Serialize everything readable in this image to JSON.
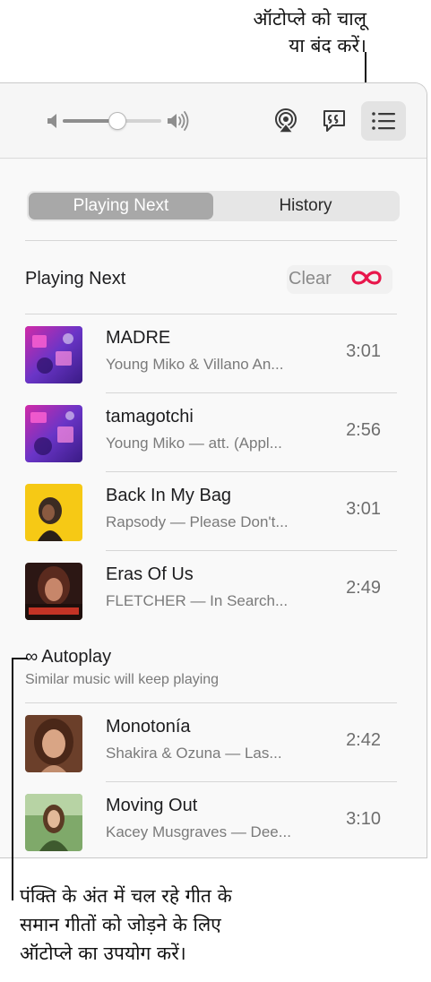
{
  "callouts": {
    "autoplay_toggle_line1": "ऑटोप्ले को चालू",
    "autoplay_toggle_line2": "या बंद करें।",
    "autoplay_use_line1": "पंक्ति के अंत में चल रहे गीत के",
    "autoplay_use_line2": "समान गीतों को जोड़ने के लिए",
    "autoplay_use_line3": "ऑटोप्ले का उपयोग करें।"
  },
  "toolbar": {
    "volume_level": 0.55,
    "icons": [
      "volume-low-icon",
      "volume-high-icon",
      "airplay-icon",
      "lyrics-icon",
      "queue-list-icon"
    ]
  },
  "tabs": [
    {
      "label": "Playing Next",
      "active": true
    },
    {
      "label": "History",
      "active": false
    }
  ],
  "playing_next": {
    "title": "Playing Next",
    "clear_label": "Clear",
    "autoplay_symbol": "∞",
    "autoplay_color": "#e8164b",
    "tracks": [
      {
        "title": "MADRE",
        "subtitle": "Young Miko & Villano An...",
        "duration": "3:01",
        "art": "purple"
      },
      {
        "title": "tamagotchi",
        "subtitle": "Young Miko — att. (Appl...",
        "duration": "2:56",
        "art": "purple"
      },
      {
        "title": "Back In My Bag",
        "subtitle": "Rapsody — Please Don't...",
        "duration": "3:01",
        "art": "yellow"
      },
      {
        "title": "Eras Of Us",
        "subtitle": "FLETCHER — In Search...",
        "duration": "2:49",
        "art": "antidote"
      }
    ]
  },
  "autoplay": {
    "symbol": "∞",
    "title": "Autoplay",
    "subtitle": "Similar music will keep playing",
    "tracks": [
      {
        "title": "Monotonía",
        "subtitle": "Shakira & Ozuna — Las...",
        "duration": "2:42",
        "art": "portrait"
      },
      {
        "title": "Moving Out",
        "subtitle": "Kacey Musgraves — Dee...",
        "duration": "3:10",
        "art": "green"
      }
    ]
  }
}
